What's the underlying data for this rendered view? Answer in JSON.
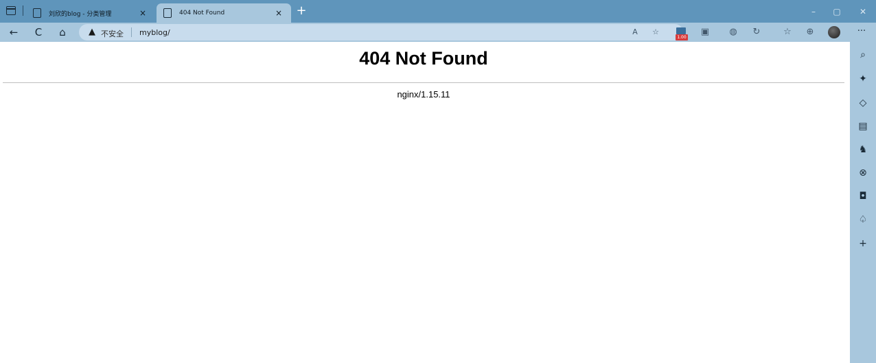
{
  "browser": {
    "tabs": [
      {
        "title": "刘欣的blog - 分类管理",
        "close": "×",
        "active": false
      },
      {
        "title": "404 Not Found",
        "close": "×",
        "active": true
      }
    ],
    "new_tab": "+",
    "window_controls": {
      "minimize": "–",
      "maximize": "▢",
      "close": "✕"
    },
    "nav": {
      "back": "←",
      "refresh": "C",
      "home": "⌂"
    },
    "address_bar": {
      "security_icon": "warning-icon",
      "security_text": "不安全",
      "url": "myblog/"
    },
    "address_icons": {
      "read_aloud": "A",
      "favorite": "☆"
    },
    "extensions": {
      "badge_text": "1.00"
    },
    "more": "···"
  },
  "sidebar_icons": [
    "search-icon",
    "copilot-icon",
    "tag-icon",
    "briefcase-icon",
    "chess-icon",
    "office-icon",
    "outlook-icon",
    "tree-icon",
    "add-icon"
  ],
  "page": {
    "heading": "404 Not Found",
    "server": "nginx/1.15.11"
  },
  "colors": {
    "titlebar": "#5f95bb",
    "toolbar": "#a8c7dd",
    "content": "#ffffff"
  }
}
